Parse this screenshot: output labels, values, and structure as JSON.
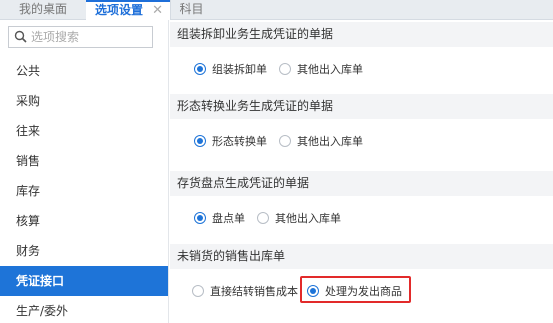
{
  "tabs": [
    {
      "label": "我的桌面"
    },
    {
      "label": "选项设置",
      "close": "✕"
    },
    {
      "label": "科目"
    }
  ],
  "search": {
    "placeholder": "选项搜索"
  },
  "sidebar": {
    "items": [
      {
        "label": "公共"
      },
      {
        "label": "采购"
      },
      {
        "label": "往来"
      },
      {
        "label": "销售"
      },
      {
        "label": "库存"
      },
      {
        "label": "核算"
      },
      {
        "label": "财务"
      },
      {
        "label": "凭证接口",
        "active": true
      },
      {
        "label": "生产/委外"
      }
    ]
  },
  "sections": [
    {
      "title": "组装拆卸业务生成凭证的单据",
      "options": [
        {
          "label": "组装拆卸单",
          "checked": true
        },
        {
          "label": "其他出入库单",
          "checked": false
        }
      ]
    },
    {
      "title": "形态转换业务生成凭证的单据",
      "options": [
        {
          "label": "形态转换单",
          "checked": true
        },
        {
          "label": "其他出入库单",
          "checked": false
        }
      ]
    },
    {
      "title": "存货盘点生成凭证的单据",
      "options": [
        {
          "label": "盘点单",
          "checked": true
        },
        {
          "label": "其他出入库单",
          "checked": false
        }
      ]
    },
    {
      "title": "未销货的销售出库单",
      "options": [
        {
          "label": "直接结转销售成本",
          "checked": false
        },
        {
          "label": "处理为发出商品",
          "checked": true
        }
      ]
    }
  ],
  "colors": {
    "accent": "#1e74d8",
    "highlight": "#e22a2a",
    "header_bg": "#f3f4f6"
  }
}
